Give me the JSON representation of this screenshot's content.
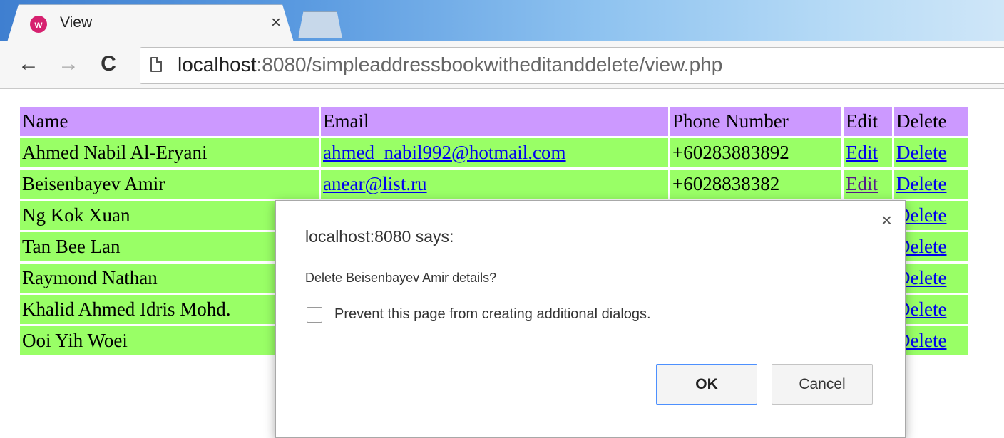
{
  "browser": {
    "tab_title": "View",
    "tab_favicon": "wamp-icon",
    "url_host": "localhost",
    "url_path": ":8080/simpleaddressbookwitheditanddelete/view.php"
  },
  "table": {
    "headers": [
      "Name",
      "Email",
      "Phone Number",
      "Edit",
      "Delete"
    ],
    "rows": [
      {
        "name": "Ahmed Nabil Al-Eryani",
        "email": "ahmed_nabil992@hotmail.com",
        "phone": "+60283883892",
        "edit": "Edit",
        "delete": "Delete"
      },
      {
        "name": "Beisenbayev Amir",
        "email": "anear@list.ru",
        "phone": "+6028838382",
        "edit": "Edit",
        "delete": "Delete"
      },
      {
        "name": "Ng Kok Xuan",
        "email": "",
        "phone": "",
        "edit": "",
        "delete": "Delete"
      },
      {
        "name": "Tan Bee Lan",
        "email": "",
        "phone": "",
        "edit": "",
        "delete": "Delete"
      },
      {
        "name": "Raymond Nathan",
        "email": "",
        "phone": "",
        "edit": "",
        "delete": "Delete"
      },
      {
        "name": "Khalid Ahmed Idris Mohd.",
        "email": "",
        "phone": "",
        "edit": "",
        "delete": "Delete"
      },
      {
        "name": "Ooi Yih Woei",
        "email": "",
        "phone": "",
        "edit": "",
        "delete": "Delete"
      }
    ]
  },
  "dialog": {
    "title": "localhost:8080 says:",
    "message": "Delete Beisenbayev Amir details?",
    "checkbox_label": "Prevent this page from creating additional dialogs.",
    "checkbox_checked": false,
    "ok_label": "OK",
    "cancel_label": "Cancel",
    "close_glyph": "×"
  },
  "colors": {
    "header_bg": "#cc99ff",
    "row_bg": "#99ff66",
    "link": "#0000ee",
    "visited_link": "#551a8b"
  }
}
